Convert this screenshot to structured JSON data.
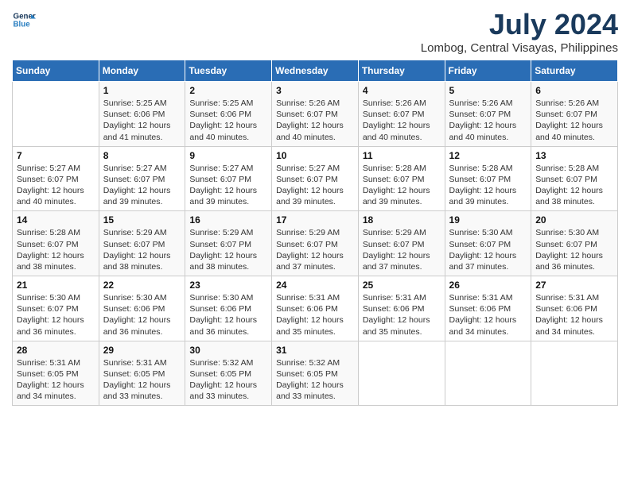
{
  "logo": {
    "line1": "General",
    "line2": "Blue"
  },
  "title": "July 2024",
  "subtitle": "Lombog, Central Visayas, Philippines",
  "header_colors": {
    "bg": "#2a6db5",
    "text": "#ffffff"
  },
  "weekdays": [
    "Sunday",
    "Monday",
    "Tuesday",
    "Wednesday",
    "Thursday",
    "Friday",
    "Saturday"
  ],
  "weeks": [
    [
      {
        "day": "",
        "info": ""
      },
      {
        "day": "1",
        "info": "Sunrise: 5:25 AM\nSunset: 6:06 PM\nDaylight: 12 hours\nand 41 minutes."
      },
      {
        "day": "2",
        "info": "Sunrise: 5:25 AM\nSunset: 6:06 PM\nDaylight: 12 hours\nand 40 minutes."
      },
      {
        "day": "3",
        "info": "Sunrise: 5:26 AM\nSunset: 6:07 PM\nDaylight: 12 hours\nand 40 minutes."
      },
      {
        "day": "4",
        "info": "Sunrise: 5:26 AM\nSunset: 6:07 PM\nDaylight: 12 hours\nand 40 minutes."
      },
      {
        "day": "5",
        "info": "Sunrise: 5:26 AM\nSunset: 6:07 PM\nDaylight: 12 hours\nand 40 minutes."
      },
      {
        "day": "6",
        "info": "Sunrise: 5:26 AM\nSunset: 6:07 PM\nDaylight: 12 hours\nand 40 minutes."
      }
    ],
    [
      {
        "day": "7",
        "info": "Sunrise: 5:27 AM\nSunset: 6:07 PM\nDaylight: 12 hours\nand 40 minutes."
      },
      {
        "day": "8",
        "info": "Sunrise: 5:27 AM\nSunset: 6:07 PM\nDaylight: 12 hours\nand 39 minutes."
      },
      {
        "day": "9",
        "info": "Sunrise: 5:27 AM\nSunset: 6:07 PM\nDaylight: 12 hours\nand 39 minutes."
      },
      {
        "day": "10",
        "info": "Sunrise: 5:27 AM\nSunset: 6:07 PM\nDaylight: 12 hours\nand 39 minutes."
      },
      {
        "day": "11",
        "info": "Sunrise: 5:28 AM\nSunset: 6:07 PM\nDaylight: 12 hours\nand 39 minutes."
      },
      {
        "day": "12",
        "info": "Sunrise: 5:28 AM\nSunset: 6:07 PM\nDaylight: 12 hours\nand 39 minutes."
      },
      {
        "day": "13",
        "info": "Sunrise: 5:28 AM\nSunset: 6:07 PM\nDaylight: 12 hours\nand 38 minutes."
      }
    ],
    [
      {
        "day": "14",
        "info": "Sunrise: 5:28 AM\nSunset: 6:07 PM\nDaylight: 12 hours\nand 38 minutes."
      },
      {
        "day": "15",
        "info": "Sunrise: 5:29 AM\nSunset: 6:07 PM\nDaylight: 12 hours\nand 38 minutes."
      },
      {
        "day": "16",
        "info": "Sunrise: 5:29 AM\nSunset: 6:07 PM\nDaylight: 12 hours\nand 38 minutes."
      },
      {
        "day": "17",
        "info": "Sunrise: 5:29 AM\nSunset: 6:07 PM\nDaylight: 12 hours\nand 37 minutes."
      },
      {
        "day": "18",
        "info": "Sunrise: 5:29 AM\nSunset: 6:07 PM\nDaylight: 12 hours\nand 37 minutes."
      },
      {
        "day": "19",
        "info": "Sunrise: 5:30 AM\nSunset: 6:07 PM\nDaylight: 12 hours\nand 37 minutes."
      },
      {
        "day": "20",
        "info": "Sunrise: 5:30 AM\nSunset: 6:07 PM\nDaylight: 12 hours\nand 36 minutes."
      }
    ],
    [
      {
        "day": "21",
        "info": "Sunrise: 5:30 AM\nSunset: 6:07 PM\nDaylight: 12 hours\nand 36 minutes."
      },
      {
        "day": "22",
        "info": "Sunrise: 5:30 AM\nSunset: 6:06 PM\nDaylight: 12 hours\nand 36 minutes."
      },
      {
        "day": "23",
        "info": "Sunrise: 5:30 AM\nSunset: 6:06 PM\nDaylight: 12 hours\nand 36 minutes."
      },
      {
        "day": "24",
        "info": "Sunrise: 5:31 AM\nSunset: 6:06 PM\nDaylight: 12 hours\nand 35 minutes."
      },
      {
        "day": "25",
        "info": "Sunrise: 5:31 AM\nSunset: 6:06 PM\nDaylight: 12 hours\nand 35 minutes."
      },
      {
        "day": "26",
        "info": "Sunrise: 5:31 AM\nSunset: 6:06 PM\nDaylight: 12 hours\nand 34 minutes."
      },
      {
        "day": "27",
        "info": "Sunrise: 5:31 AM\nSunset: 6:06 PM\nDaylight: 12 hours\nand 34 minutes."
      }
    ],
    [
      {
        "day": "28",
        "info": "Sunrise: 5:31 AM\nSunset: 6:05 PM\nDaylight: 12 hours\nand 34 minutes."
      },
      {
        "day": "29",
        "info": "Sunrise: 5:31 AM\nSunset: 6:05 PM\nDaylight: 12 hours\nand 33 minutes."
      },
      {
        "day": "30",
        "info": "Sunrise: 5:32 AM\nSunset: 6:05 PM\nDaylight: 12 hours\nand 33 minutes."
      },
      {
        "day": "31",
        "info": "Sunrise: 5:32 AM\nSunset: 6:05 PM\nDaylight: 12 hours\nand 33 minutes."
      },
      {
        "day": "",
        "info": ""
      },
      {
        "day": "",
        "info": ""
      },
      {
        "day": "",
        "info": ""
      }
    ]
  ]
}
